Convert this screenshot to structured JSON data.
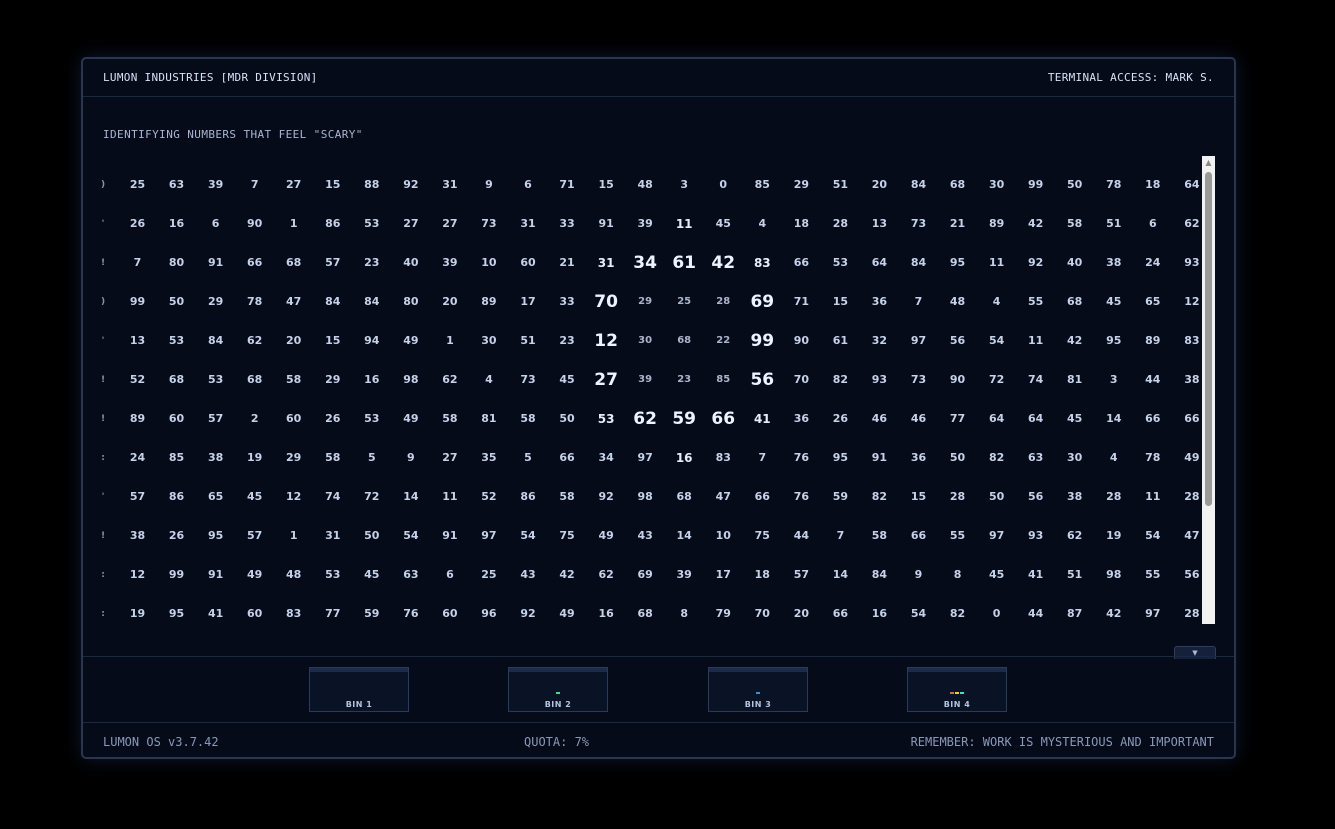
{
  "header": {
    "company": "LUMON INDUSTRIES [MDR DIVISION]",
    "terminal_access": "TERMINAL ACCESS: MARK S."
  },
  "task": {
    "title": "IDENTIFYING NUMBERS THAT FEEL \"SCARY\""
  },
  "grid": {
    "edge_glyphs": [
      ")",
      "'",
      "!",
      ")",
      "'",
      "!",
      "!",
      ":",
      "'",
      "!",
      ":",
      ":"
    ],
    "rows": [
      [
        25,
        63,
        39,
        7,
        27,
        15,
        88,
        92,
        31,
        9,
        6,
        71,
        15,
        48,
        3,
        0,
        85,
        29,
        51,
        20,
        84,
        68,
        30,
        99,
        50,
        78,
        18,
        64
      ],
      [
        26,
        16,
        6,
        90,
        1,
        86,
        53,
        27,
        27,
        73,
        31,
        33,
        91,
        39,
        11,
        45,
        4,
        18,
        28,
        13,
        73,
        21,
        89,
        42,
        58,
        51,
        6,
        62
      ],
      [
        7,
        80,
        91,
        66,
        68,
        57,
        23,
        40,
        39,
        10,
        60,
        21,
        31,
        34,
        61,
        42,
        83,
        66,
        53,
        64,
        84,
        95,
        11,
        92,
        40,
        38,
        24,
        93
      ],
      [
        99,
        50,
        29,
        78,
        47,
        84,
        84,
        80,
        20,
        89,
        17,
        33,
        70,
        29,
        25,
        28,
        69,
        71,
        15,
        36,
        7,
        48,
        4,
        55,
        68,
        45,
        65,
        12
      ],
      [
        13,
        53,
        84,
        62,
        20,
        15,
        94,
        49,
        1,
        30,
        51,
        23,
        12,
        30,
        68,
        22,
        99,
        90,
        61,
        32,
        97,
        56,
        54,
        11,
        42,
        95,
        89,
        83
      ],
      [
        52,
        68,
        53,
        68,
        58,
        29,
        16,
        98,
        62,
        4,
        73,
        45,
        27,
        39,
        23,
        85,
        56,
        70,
        82,
        93,
        73,
        90,
        72,
        74,
        81,
        3,
        44,
        38
      ],
      [
        89,
        60,
        57,
        2,
        60,
        26,
        53,
        49,
        58,
        81,
        58,
        50,
        53,
        62,
        59,
        66,
        41,
        36,
        26,
        46,
        46,
        77,
        64,
        64,
        45,
        14,
        66,
        66
      ],
      [
        24,
        85,
        38,
        19,
        29,
        58,
        5,
        9,
        27,
        35,
        5,
        66,
        34,
        97,
        16,
        83,
        7,
        76,
        95,
        91,
        36,
        50,
        82,
        63,
        30,
        4,
        78,
        49
      ],
      [
        57,
        86,
        65,
        45,
        12,
        74,
        72,
        14,
        11,
        52,
        86,
        58,
        92,
        98,
        68,
        47,
        66,
        76,
        59,
        82,
        15,
        28,
        50,
        56,
        38,
        28,
        11,
        28
      ],
      [
        38,
        26,
        95,
        57,
        1,
        31,
        50,
        54,
        91,
        97,
        54,
        75,
        49,
        43,
        14,
        10,
        75,
        44,
        7,
        58,
        66,
        55,
        97,
        93,
        62,
        19,
        54,
        47
      ],
      [
        12,
        99,
        91,
        49,
        48,
        53,
        45,
        63,
        6,
        25,
        43,
        42,
        62,
        69,
        39,
        17,
        18,
        57,
        14,
        84,
        9,
        8,
        45,
        41,
        51,
        98,
        55,
        56
      ],
      [
        19,
        95,
        41,
        60,
        83,
        77,
        59,
        76,
        60,
        96,
        92,
        49,
        16,
        68,
        8,
        79,
        70,
        20,
        66,
        16,
        54,
        82,
        0,
        44,
        87,
        42,
        97,
        28
      ]
    ],
    "emphasis": {
      "2": {
        "12": "mid",
        "13": "big",
        "14": "big",
        "15": "big",
        "16": "mid"
      },
      "3": {
        "12": "big",
        "13": "dim",
        "14": "dim",
        "15": "dim",
        "16": "big"
      },
      "4": {
        "12": "big",
        "13": "dim",
        "14": "dim",
        "15": "dim",
        "16": "big"
      },
      "5": {
        "12": "big",
        "13": "dim",
        "14": "dim",
        "15": "dim",
        "16": "big"
      },
      "6": {
        "12": "mid",
        "13": "big",
        "14": "big",
        "15": "big",
        "16": "mid"
      },
      "1": {
        "14": "mid"
      },
      "7": {
        "14": "mid"
      }
    }
  },
  "scrollbar": {
    "up_arrow": "▲"
  },
  "toggle_tab": {
    "label": "▼"
  },
  "bins": [
    {
      "label": "BIN 1",
      "fill": []
    },
    {
      "label": "BIN 2",
      "fill": [
        "#3fe08a"
      ]
    },
    {
      "label": "BIN 3",
      "fill": [
        "#3f8be0"
      ]
    },
    {
      "label": "BIN 4",
      "fill": [
        "#e06a3f",
        "#e0d23f",
        "#3fe0c8"
      ]
    }
  ],
  "footer": {
    "os_version": "LUMON OS v3.7.42",
    "quota": "QUOTA: 7%",
    "reminder": "REMEMBER: WORK IS MYSTERIOUS AND IMPORTANT"
  }
}
